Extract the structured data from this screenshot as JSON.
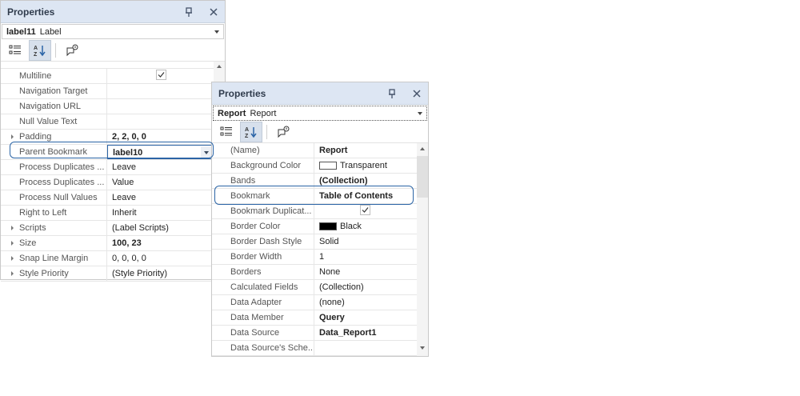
{
  "panel1": {
    "title": "Properties",
    "selector": {
      "name": "label11",
      "type": "Label"
    },
    "rows": [
      {
        "name": "Multiline",
        "value": "",
        "checked": true
      },
      {
        "name": "Navigation Target",
        "value": ""
      },
      {
        "name": "Navigation URL",
        "value": ""
      },
      {
        "name": "Null Value Text",
        "value": ""
      },
      {
        "name": "Padding",
        "value": "2, 2, 0, 0",
        "bold": true,
        "expandable": true
      },
      {
        "name": "Parent Bookmark",
        "value": "label10",
        "bold": true,
        "dropdown": true
      },
      {
        "name": "Process Duplicates ...",
        "value": "Leave"
      },
      {
        "name": "Process Duplicates ...",
        "value": "Value"
      },
      {
        "name": "Process Null Values",
        "value": "Leave"
      },
      {
        "name": "Right to Left",
        "value": "Inherit"
      },
      {
        "name": "Scripts",
        "value": "(Label Scripts)",
        "expandable": true
      },
      {
        "name": "Size",
        "value": "100, 23",
        "bold": true,
        "expandable": true
      },
      {
        "name": "Snap Line Margin",
        "value": "0, 0, 0, 0",
        "expandable": true
      },
      {
        "name": "Style Priority",
        "value": "(Style Priority)",
        "expandable": true
      }
    ]
  },
  "panel2": {
    "title": "Properties",
    "selector": {
      "name": "Report",
      "type": "Report"
    },
    "rows": [
      {
        "name": "(Name)",
        "value": "Report",
        "bold": true
      },
      {
        "name": "Background Color",
        "value": "Transparent",
        "swatch": "#ffffff"
      },
      {
        "name": "Bands",
        "value": "(Collection)",
        "bold": true
      },
      {
        "name": "Bookmark",
        "value": "Table of Contents",
        "bold": true
      },
      {
        "name": "Bookmark Duplicat...",
        "value": "",
        "checked": true
      },
      {
        "name": "Border Color",
        "value": "Black",
        "swatch": "#000000"
      },
      {
        "name": "Border Dash Style",
        "value": "Solid"
      },
      {
        "name": "Border Width",
        "value": "1"
      },
      {
        "name": "Borders",
        "value": "None"
      },
      {
        "name": "Calculated Fields",
        "value": "(Collection)"
      },
      {
        "name": "Data Adapter",
        "value": "(none)"
      },
      {
        "name": "Data Member",
        "value": "Query",
        "bold": true
      },
      {
        "name": "Data Source",
        "value": "Data_Report1",
        "bold": true
      },
      {
        "name": "Data Source's Sche...",
        "value": ""
      }
    ]
  },
  "colors": {
    "titlebar": "#dde6f3",
    "highlight": "#2b64a6"
  }
}
